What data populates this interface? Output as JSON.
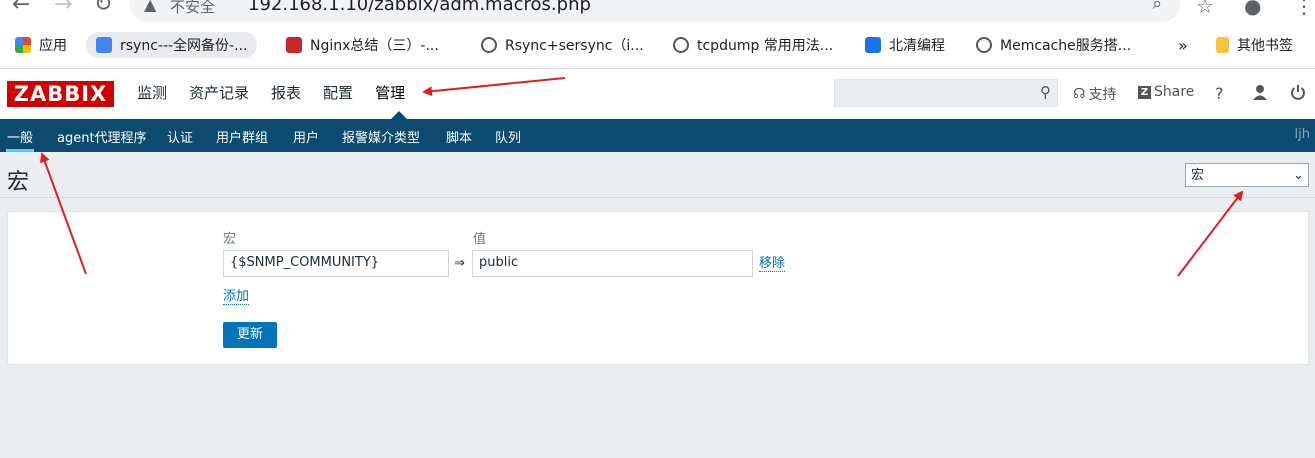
{
  "browser": {
    "security_text": "不安全",
    "url": "192.168.1.10/zabbix/adm.macros.php",
    "bookmarks": [
      {
        "label": "应用",
        "color": "#f4b400"
      },
      {
        "label": "rsync---全网备份-...",
        "color": "#4285f4"
      },
      {
        "label": "Nginx总结（三）-...",
        "color": "#c62828"
      },
      {
        "label": "Rsync+sersync（i...",
        "color": "#555555"
      },
      {
        "label": "tcpdump 常用用法...",
        "color": "#555555"
      },
      {
        "label": "北清编程",
        "color": "#1a73e8"
      },
      {
        "label": "Memcache服务搭...",
        "color": "#555555"
      },
      {
        "label": "»",
        "color": ""
      },
      {
        "label": "其他书签",
        "color": "#f6c343"
      }
    ]
  },
  "header": {
    "logo": "ZABBIX",
    "menu": [
      "监测",
      "资产记录",
      "报表",
      "配置",
      "管理"
    ],
    "selected_menu": "管理",
    "support": "支持",
    "share": "Share",
    "help": "?"
  },
  "subnav": {
    "items": [
      "一般",
      "agent代理程序",
      "认证",
      "用户群组",
      "用户",
      "报警媒介类型",
      "脚本",
      "队列"
    ],
    "user": "ljh"
  },
  "page": {
    "title": "宏",
    "selector_value": "宏",
    "form": {
      "macro_label": "宏",
      "value_label": "值",
      "macro_value": "{$SNMP_COMMUNITY}",
      "arrow": "⇒",
      "value_value": "public",
      "remove": "移除",
      "add": "添加",
      "update": "更新"
    }
  },
  "colors": {
    "brand_red": "#d40000",
    "subnav_bg": "#0c4b70",
    "link": "#0275b8",
    "annotation": "#e02020"
  }
}
